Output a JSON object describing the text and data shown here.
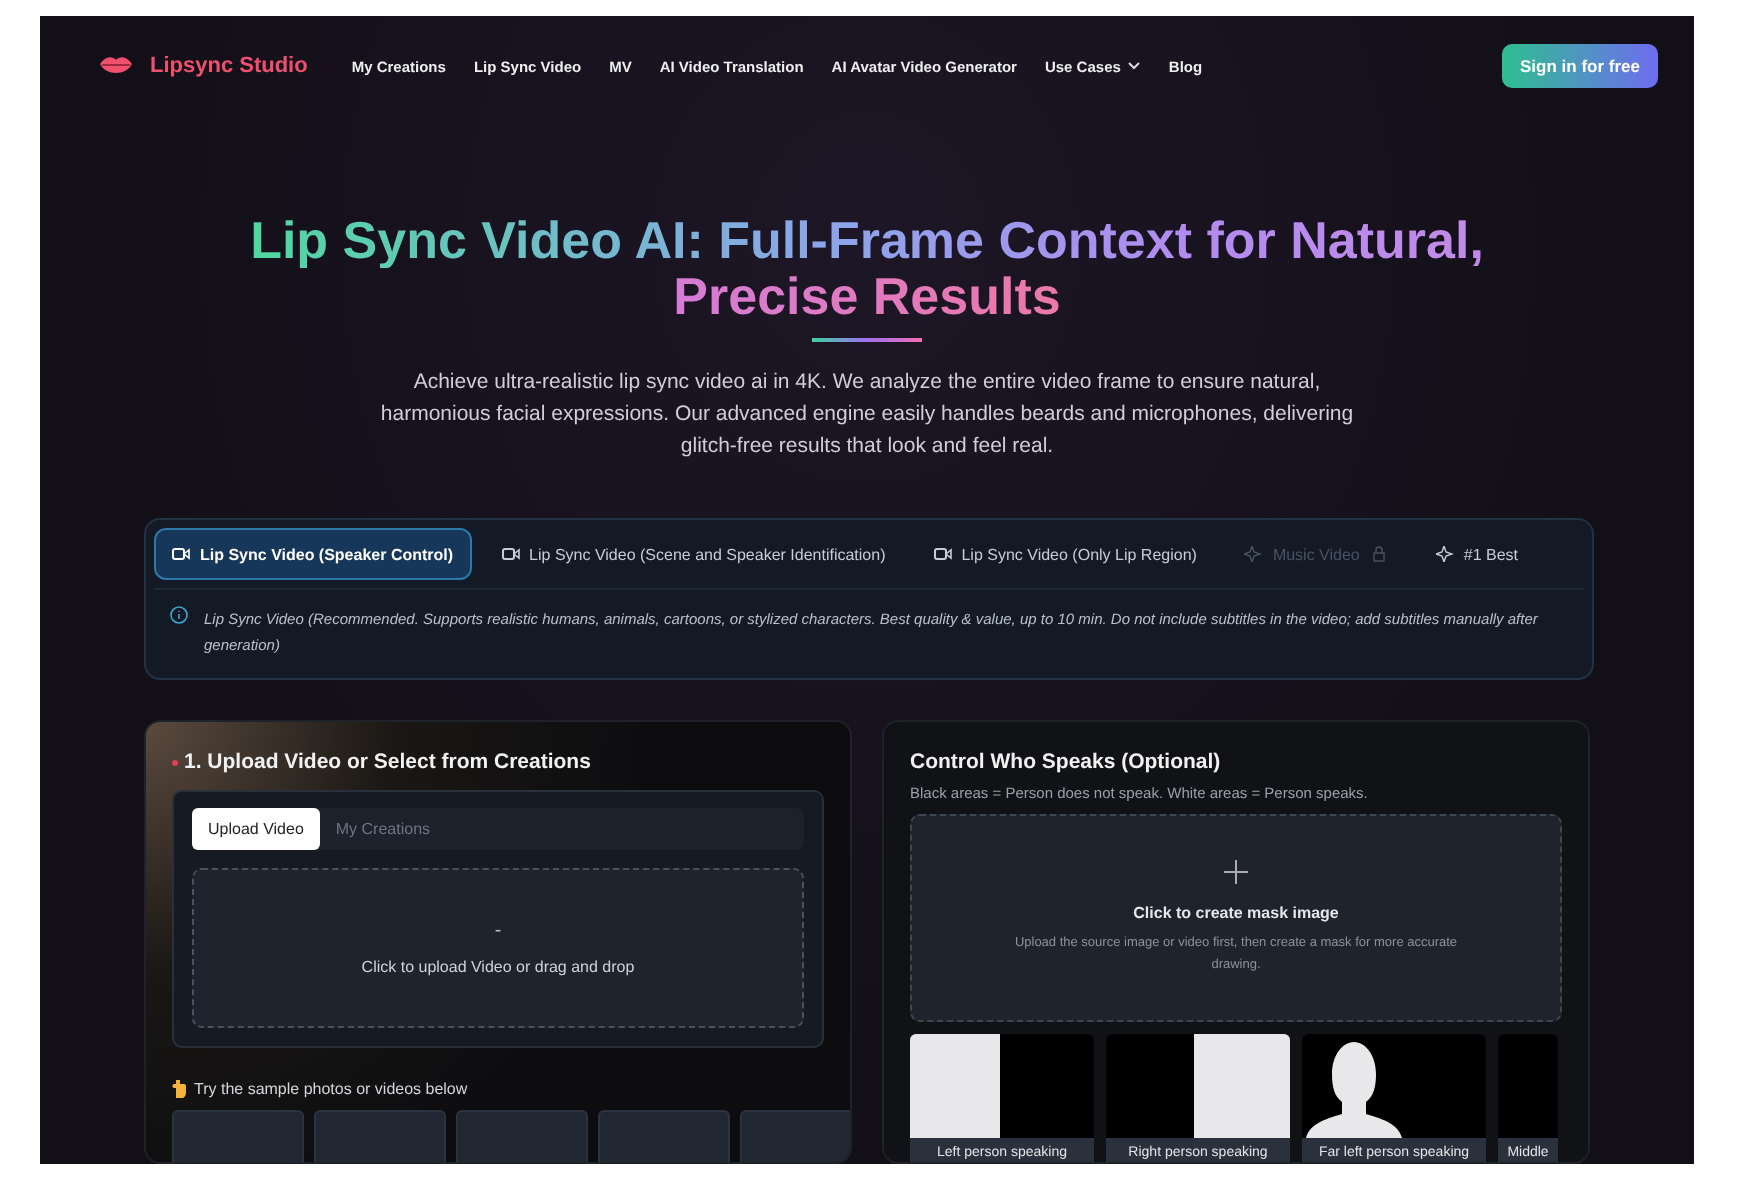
{
  "header": {
    "logo": "Lipsync Studio",
    "nav": [
      {
        "label": "My Creations",
        "kind": "link"
      },
      {
        "label": "Lip Sync Video",
        "kind": "link"
      },
      {
        "label": "MV",
        "kind": "link"
      },
      {
        "label": "AI Video Translation",
        "kind": "link"
      },
      {
        "label": "AI Avatar Video Generator",
        "kind": "link"
      },
      {
        "label": "Use Cases",
        "kind": "dropdown"
      },
      {
        "label": "Blog",
        "kind": "link"
      }
    ],
    "signin": "Sign in for free"
  },
  "hero": {
    "title_line1": "Lip Sync Video AI: Full-Frame Context for Natural,",
    "title_line2": "Precise Results",
    "description": "Achieve ultra-realistic lip sync video ai in 4K. We analyze the entire video frame to ensure natural, harmonious facial expressions. Our advanced engine easily handles beards and microphones, delivering glitch-free results that look and feel real."
  },
  "mode_tabs": [
    {
      "label": "Lip Sync Video (Speaker Control)",
      "kind": "video",
      "selected": true,
      "disabled": false
    },
    {
      "label": "Lip Sync Video (Scene and Speaker Identification)",
      "kind": "video",
      "selected": false,
      "disabled": false
    },
    {
      "label": "Lip Sync Video (Only Lip Region)",
      "kind": "video",
      "selected": false,
      "disabled": false
    },
    {
      "label": "Music Video",
      "kind": "sparkle",
      "selected": false,
      "disabled": true
    },
    {
      "label": "#1 Best",
      "kind": "sparkle",
      "selected": false,
      "disabled": false
    }
  ],
  "mode_note": "Lip Sync Video (Recommended. Supports realistic humans, animals, cartoons, or stylized characters. Best quality & value, up to 10 min. Do not include subtitles in the video; add subtitles manually after generation)",
  "upload_panel": {
    "title": "1. Upload Video or Select from Creations",
    "tabs": [
      {
        "label": "Upload Video",
        "selected": true
      },
      {
        "label": "My Creations",
        "selected": false
      }
    ],
    "dropzone_icon": "-",
    "dropzone_text": "Click to upload Video or drag and drop",
    "samples_hint": "Try the sample photos or videos below"
  },
  "mask_panel": {
    "title": "Control Who Speaks (Optional)",
    "subtitle": "Black areas = Person does not speak. White areas = Person speaks.",
    "create_title": "Click to create mask image",
    "create_text": "Upload the source image or video first, then create a mask for more accurate drawing.",
    "presets": [
      {
        "label": "Left person speaking",
        "kind": "left"
      },
      {
        "label": "Right person speaking",
        "kind": "right"
      },
      {
        "label": "Far left person speaking",
        "kind": "silhouette"
      },
      {
        "label": "Middle",
        "kind": "middle"
      }
    ]
  }
}
